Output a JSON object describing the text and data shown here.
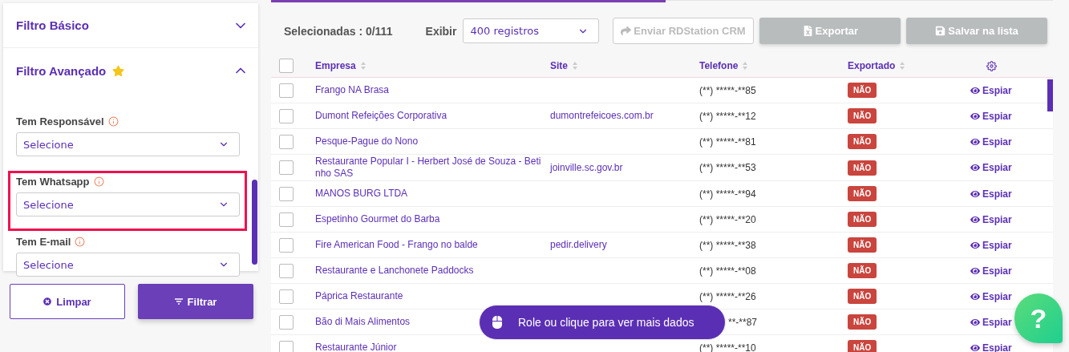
{
  "sidebar": {
    "sections": [
      {
        "title": "Filtro Básico",
        "expanded": false,
        "starred": false
      },
      {
        "title": "Filtro Avançado",
        "expanded": true,
        "starred": true
      }
    ],
    "fields": [
      {
        "label": "Tem Responsável",
        "value": "Selecione",
        "highlighted": false
      },
      {
        "label": "Tem Whatsapp",
        "value": "Selecione",
        "highlighted": true
      },
      {
        "label": "Tem E-mail",
        "value": "Selecione",
        "highlighted": false
      }
    ],
    "buttons": [
      {
        "label": "Limpar",
        "kind": "clear"
      },
      {
        "label": "Filtrar",
        "kind": "filter"
      }
    ]
  },
  "toolbar": {
    "selected_count": "Selecionadas : 0/111",
    "show_label": "Exibir",
    "show_value": "400 registros",
    "buttons": [
      {
        "label": "Enviar RDStation CRM",
        "kind": "send",
        "disabled": true
      },
      {
        "label": "Exportar",
        "kind": "export",
        "disabled": true
      },
      {
        "label": "Salvar na lista",
        "kind": "save",
        "disabled": true
      }
    ]
  },
  "table": {
    "select_all_checked": false,
    "columns": [
      "Empresa",
      "Site",
      "Telefone",
      "Exportado"
    ],
    "rows": [
      {
        "empresa": "Frango NA Brasa",
        "phone": "(**) *****-**85",
        "exportado": "NÃO",
        "action": "Espiar",
        "checked": false,
        "covered": false
      },
      {
        "empresa": "Dumont Refeições Corporativa",
        "site": "dumontrefeicoes.com.br",
        "phone": "(**) *****-**12",
        "exportado": "NÃO",
        "action": "Espiar",
        "checked": false,
        "covered": false
      },
      {
        "empresa": "Pesque-Pague do Nono",
        "phone": "(**) *****-**81",
        "exportado": "NÃO",
        "action": "Espiar",
        "checked": false,
        "covered": false
      },
      {
        "empresa": "Restaurante Popular I - Herbert José de Souza - Betinho SAS",
        "site": "joinville.sc.gov.br",
        "phone": "(**) *****-**53",
        "exportado": "NÃO",
        "action": "Espiar",
        "checked": false,
        "covered": false
      },
      {
        "empresa": "MANOS BURG LTDA",
        "phone": "(**) *****-**94",
        "exportado": "NÃO",
        "action": "Espiar",
        "checked": false,
        "covered": false
      },
      {
        "empresa": "Espetinho Gourmet do Barba",
        "phone": "(**) *****-**20",
        "exportado": "NÃO",
        "action": "Espiar",
        "checked": false,
        "covered": false
      },
      {
        "empresa": "Fire American Food - Frango no balde",
        "site": "pedir.delivery",
        "phone": "(**) *****-**38",
        "exportado": "NÃO",
        "action": "Espiar",
        "checked": false,
        "covered": false
      },
      {
        "empresa": "Restaurante e Lanchonete Paddocks",
        "phone": "(**) *****-**08",
        "exportado": "NÃO",
        "action": "Espiar",
        "checked": false,
        "covered": false
      },
      {
        "empresa": "Páprica Restaurante",
        "phone": "(**) *****-**26",
        "exportado": "NÃO",
        "action": "Espiar",
        "checked": false,
        "covered": false
      },
      {
        "empresa": "Bão di Mais Alimentos",
        "phone": "**-**87",
        "exportado": "NÃO",
        "action": "Espiar",
        "checked": false,
        "covered": true
      },
      {
        "empresa": "Restaurante Júnior",
        "phone": "(**) *****-**10",
        "exportado": "NÃO",
        "action": "Espiar",
        "checked": false,
        "covered": false
      }
    ]
  },
  "toast": {
    "text": "Role ou clique para ver mais dados"
  },
  "help_button": {
    "label": "?"
  }
}
